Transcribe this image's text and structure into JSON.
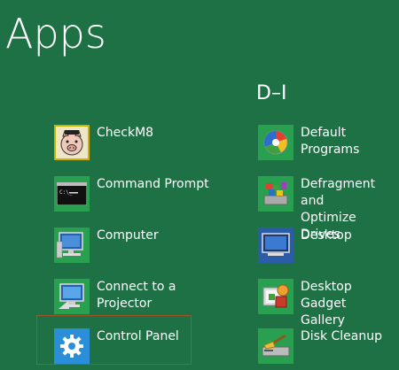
{
  "title": "Apps",
  "group_header": "D–I",
  "colors": {
    "background": "#1e7145",
    "tile_background": "#28a050",
    "selection_border": "#a0522d"
  },
  "left_column": [
    {
      "label": "CheckM8",
      "icon": "checkm8-pig-icon"
    },
    {
      "label": "Command Prompt",
      "icon": "command-prompt-icon"
    },
    {
      "label": "Computer",
      "icon": "computer-icon"
    },
    {
      "label": "Connect to a Projector",
      "icon": "projector-icon"
    },
    {
      "label": "Control Panel",
      "icon": "control-panel-gear-icon",
      "selected": true
    }
  ],
  "right_column": [
    {
      "label": "Default Programs",
      "icon": "default-programs-icon"
    },
    {
      "label": "Defragment and\nOptimize Drives",
      "icon": "defragment-icon"
    },
    {
      "label": "Desktop",
      "icon": "desktop-icon"
    },
    {
      "label": "Desktop Gadget\nGallery",
      "icon": "gadget-gallery-icon"
    },
    {
      "label": "Disk Cleanup",
      "icon": "disk-cleanup-icon"
    }
  ]
}
